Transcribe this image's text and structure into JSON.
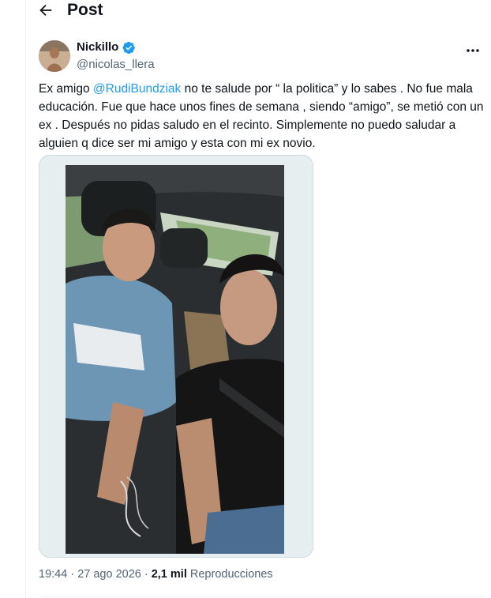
{
  "header": {
    "title": "Post",
    "back_icon": "arrow-left-icon"
  },
  "author": {
    "display_name": "Nickillo",
    "handle": "@nicolas_llera",
    "verified_icon": "verified-badge-icon",
    "verified_color": "#1d9bf0",
    "more_icon": "ellipsis-icon"
  },
  "tweet": {
    "text_before": "Ex amigo ",
    "mention": "@RudiBundziak",
    "text_after": " no te salude por “ la politica”  y lo sabes . No fue mala educación. Fue que hace unos fines de semana , siendo “amigo”, se metió con un ex . Después no pidas saludo en el recinto. Simplemente no puedo saludar a alguien q dice ser mi amigo y esta con mi ex novio.",
    "mention_color": "#1d9bf0"
  },
  "media": {
    "type": "photo",
    "subject": "selfie-in-car"
  },
  "meta": {
    "time": "19:44",
    "separator": " · ",
    "date": "27 ago 2026",
    "separator2": " · ",
    "views": "2,1 mil",
    "views_label": " Reproducciones"
  }
}
